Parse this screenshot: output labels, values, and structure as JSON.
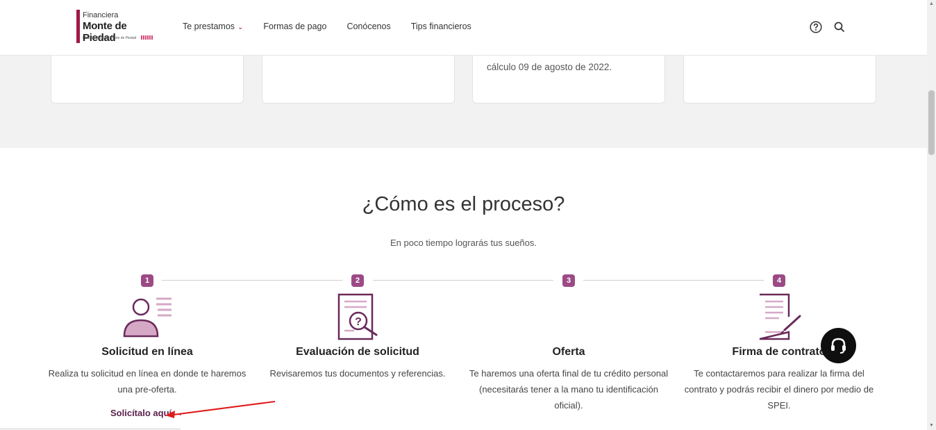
{
  "brand": {
    "line1": "Financiera",
    "line2": "Monte de Piedad",
    "line3": "Filial de Nacional Monte de Piedad",
    "color": "#a01848"
  },
  "nav": {
    "items": [
      "Te prestamos",
      "Formas de pago",
      "Conócenos",
      "Tips financieros"
    ],
    "dropdown_icon": "chevron-down-icon"
  },
  "header_icons": [
    "help-circle-icon",
    "search-icon"
  ],
  "cards": [
    {
      "text": ""
    },
    {
      "text": ""
    },
    {
      "text": "cálculo 09 de agosto de 2022."
    },
    {
      "text": ""
    }
  ],
  "process": {
    "title": "¿Cómo es el proceso?",
    "subtitle": "En poco tiempo lograrás tus sueños.",
    "accent": "#9c4a86",
    "steps": [
      {
        "number": "1",
        "title": "Solicitud en línea",
        "description": "Realiza tu solicitud en línea en donde te haremos una pre-oferta.",
        "icon": "user-profile-icon"
      },
      {
        "number": "2",
        "title": "Evaluación de solicitud",
        "description": "Revisaremos tus documentos y referencias.",
        "icon": "document-search-icon"
      },
      {
        "number": "3",
        "title": "Oferta",
        "description": "Te haremos una oferta final de tu crédito personal (necesitarás tener a la mano tu identificación oficial).",
        "icon": ""
      },
      {
        "number": "4",
        "title": "Firma de contrato",
        "description": "Te contactaremos para realizar la firma del contrato y podrás recibir el dinero por medio de SPEI.",
        "icon": "contract-sign-icon"
      }
    ],
    "cta": "Solicítalo aquí"
  },
  "chat": {
    "icon": "headset-icon"
  },
  "annotation": {
    "color": "#e01b1b"
  }
}
